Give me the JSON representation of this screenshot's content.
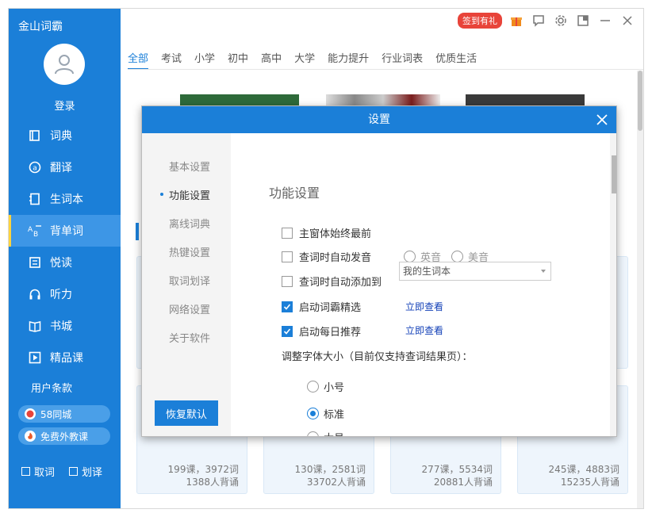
{
  "sidebar": {
    "app_title": "金山词霸",
    "login": "登录",
    "items": [
      {
        "label": "词典",
        "icon": "book-icon"
      },
      {
        "label": "翻译",
        "icon": "translate-icon"
      },
      {
        "label": "生词本",
        "icon": "notebook-icon"
      },
      {
        "label": "背单词",
        "icon": "abc-icon",
        "active": true
      },
      {
        "label": "悦读",
        "icon": "reading-icon"
      },
      {
        "label": "听力",
        "icon": "headphones-icon"
      },
      {
        "label": "书城",
        "icon": "bookstore-icon"
      },
      {
        "label": "精品课",
        "icon": "play-icon"
      }
    ],
    "terms": "用户条款",
    "pill_58": "58同城",
    "pill_teacher": "免费外教课",
    "bottom": {
      "lookup": "取词",
      "select": "划译"
    }
  },
  "header": {
    "sign_badge": "签到有礼"
  },
  "tabs": [
    "全部",
    "考试",
    "小学",
    "初中",
    "高中",
    "大学",
    "能力提升",
    "行业词表",
    "优质生活"
  ],
  "cards": [
    {
      "line1": "199课，3972词",
      "line2": "1388人背诵"
    },
    {
      "line1": "130课，2581词",
      "line2": "33702人背诵"
    },
    {
      "line1": "277课，5534词",
      "line2": "20881人背诵"
    },
    {
      "line1": "245课，4883词",
      "line2": "15235人背诵"
    }
  ],
  "dialog": {
    "title": "设置",
    "menu": [
      "基本设置",
      "功能设置",
      "离线词典",
      "热键设置",
      "取词划译",
      "网络设置",
      "关于软件"
    ],
    "restore": "恢复默认",
    "section_title": "功能设置",
    "opt_top": "主窗体始终最前",
    "opt_auto_voice": "查词时自动发音",
    "radio_uk": "英音",
    "radio_us": "美音",
    "opt_auto_add": "查词时自动添加到",
    "select_value": "我的生词本",
    "opt_featured": "启动词霸精选",
    "opt_daily": "启动每日推荐",
    "view_now_1": "立即查看",
    "view_now_2": "立即查看",
    "font_label": "调整字体大小（目前仅支持查词结果页）：",
    "font_small": "小号",
    "font_standard": "标准",
    "font_large": "大号"
  },
  "colors": {
    "primary": "#1b7fd8",
    "active_bar": "#ffd33d",
    "badge": "#e8443a",
    "link": "#1542b8"
  }
}
